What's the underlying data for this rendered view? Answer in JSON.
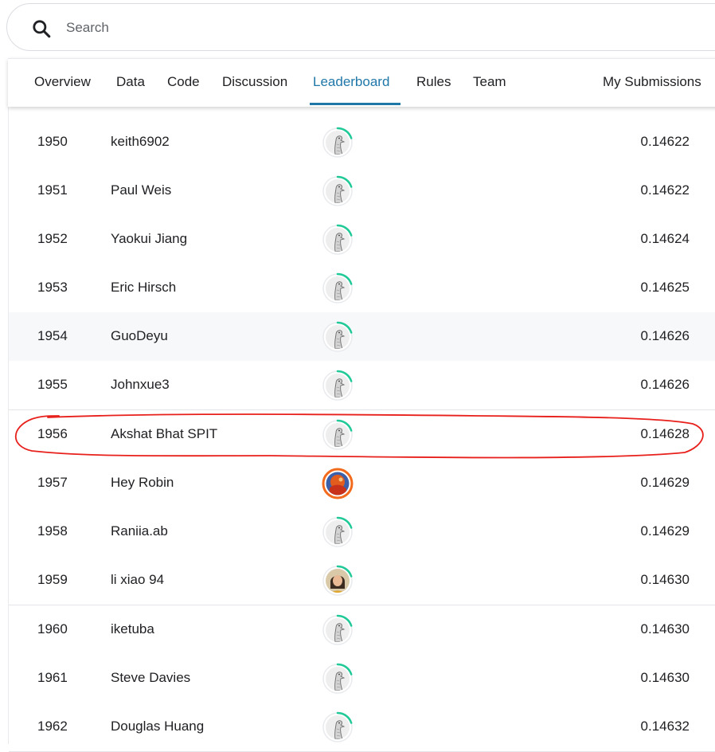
{
  "search": {
    "placeholder": "Search"
  },
  "tabs": [
    {
      "label": "Overview"
    },
    {
      "label": "Data"
    },
    {
      "label": "Code"
    },
    {
      "label": "Discussion"
    },
    {
      "label": "Leaderboard",
      "active": true
    },
    {
      "label": "Rules"
    },
    {
      "label": "Team"
    },
    {
      "label": "My Submissions"
    }
  ],
  "leaderboard": {
    "rows": [
      {
        "rank": "1950",
        "name": "keith6902",
        "score": "0.14622",
        "avatar": "default-goose-avatar"
      },
      {
        "rank": "1951",
        "name": "Paul Weis",
        "score": "0.14622",
        "avatar": "default-goose-avatar"
      },
      {
        "rank": "1952",
        "name": "Yaokui Jiang",
        "score": "0.14624",
        "avatar": "default-goose-avatar"
      },
      {
        "rank": "1953",
        "name": "Eric Hirsch",
        "score": "0.14625",
        "avatar": "default-goose-avatar"
      },
      {
        "rank": "1954",
        "name": "GuoDeyu",
        "score": "0.14626",
        "avatar": "default-goose-avatar"
      },
      {
        "rank": "1955",
        "name": "Johnxue3",
        "score": "0.14626",
        "avatar": "default-goose-avatar"
      },
      {
        "rank": "1956",
        "name": "Akshat Bhat SPIT",
        "score": "0.14628",
        "avatar": "default-goose-avatar"
      },
      {
        "rank": "1957",
        "name": "Hey Robin",
        "score": "0.14629",
        "avatar": "photo-avatar-orange"
      },
      {
        "rank": "1958",
        "name": "Raniia.ab",
        "score": "0.14629",
        "avatar": "default-goose-avatar"
      },
      {
        "rank": "1959",
        "name": "li xiao 94",
        "score": "0.14630",
        "avatar": "photo-avatar-person"
      },
      {
        "rank": "1960",
        "name": "iketuba",
        "score": "0.14630",
        "avatar": "default-goose-avatar"
      },
      {
        "rank": "1961",
        "name": "Steve Davies",
        "score": "0.14630",
        "avatar": "default-goose-avatar"
      },
      {
        "rank": "1962",
        "name": "Douglas Huang",
        "score": "0.14632",
        "avatar": "default-goose-avatar"
      }
    ]
  },
  "colors": {
    "accent": "#1f77a8",
    "progress_ring": "#20c997",
    "highlight_annotation": "#e8201c",
    "orange_ring": "#f26b1d"
  }
}
